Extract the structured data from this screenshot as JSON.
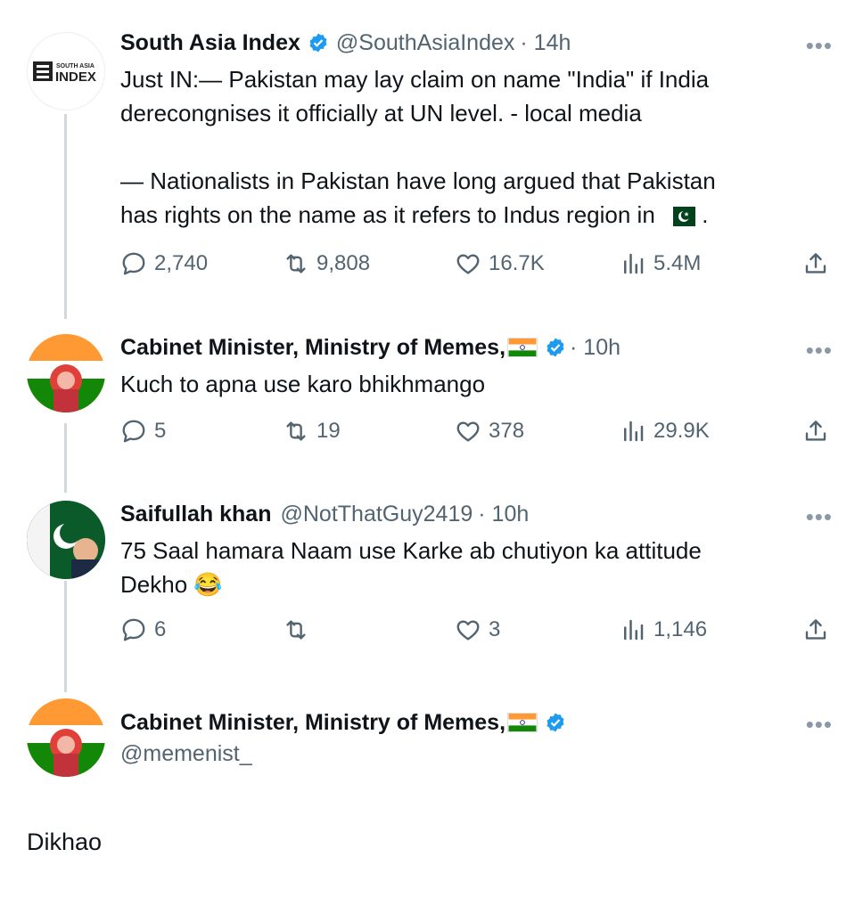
{
  "tweets": [
    {
      "avatar_text_small": "SOUTH ASIA",
      "avatar_text_big": "INDEX",
      "name": "South Asia Index",
      "handle": "@SouthAsiaIndex",
      "time": "· 14h",
      "more": "•••",
      "lines": [
        "Just IN:— Pakistan may lay claim on name \"India\" if India",
        "derecongnises it officially at UN level. - local media",
        "",
        "— Nationalists in Pakistan have long argued that Pakistan",
        "has rights on the name as it refers to Indus region in"
      ],
      "line_end": ".",
      "replies": "2,740",
      "reposts": "9,808",
      "likes": "16.7K",
      "views": "5.4M"
    },
    {
      "name": "Cabinet Minister, Ministry of Memes,",
      "time": "· 10h",
      "more": "•••",
      "lines": [
        "Kuch to apna use karo bhikhmango"
      ],
      "replies": "5",
      "reposts": "19",
      "likes": "378",
      "views": "29.9K"
    },
    {
      "name": "Saifullah khan",
      "handle": "@NotThatGuy2419",
      "time": "· 10h",
      "more": "•••",
      "lines": [
        "75 Saal hamara Naam use Karke ab chutiyon ka attitude",
        "Dekho"
      ],
      "emoji": "😂",
      "replies": "6",
      "reposts": "",
      "likes": "3",
      "views": "1,146"
    },
    {
      "name": "Cabinet Minister, Ministry of Memes,",
      "handle": "@memenist_",
      "more": "•••"
    }
  ],
  "final_text": "Dikhao",
  "colors": {
    "verified": "#1d9bf0",
    "muted": "#536471",
    "thread_line": "#cfd9de"
  }
}
